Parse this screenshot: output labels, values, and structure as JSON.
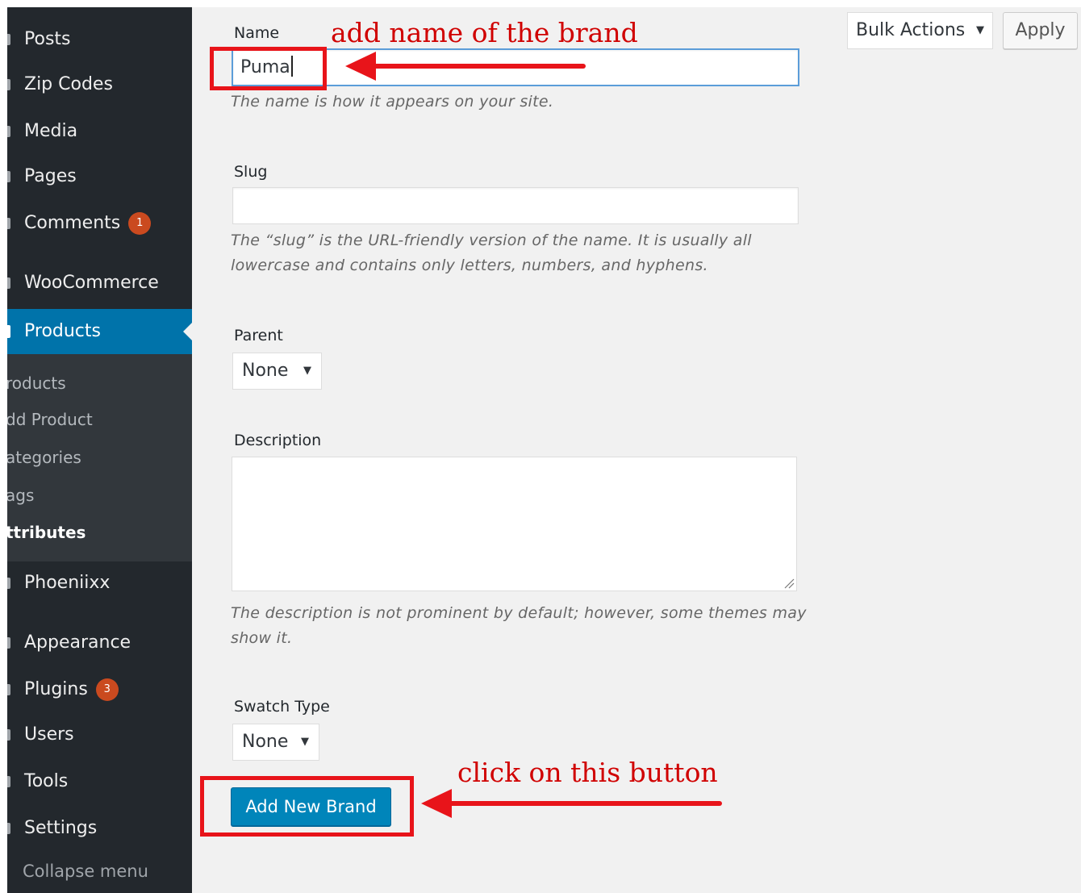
{
  "sidebar": {
    "items": [
      {
        "label": "Posts"
      },
      {
        "label": "Zip Codes"
      },
      {
        "label": "Media"
      },
      {
        "label": "Pages"
      },
      {
        "label": "Comments",
        "badge": "1"
      },
      {
        "label": "WooCommerce"
      },
      {
        "label": "Products",
        "active": true
      },
      {
        "label": "Phoeniixx"
      },
      {
        "label": "Appearance"
      },
      {
        "label": "Plugins",
        "badge": "3"
      },
      {
        "label": "Users"
      },
      {
        "label": "Tools"
      },
      {
        "label": "Settings"
      }
    ],
    "submenu": [
      {
        "label": "roducts"
      },
      {
        "label": "dd Product"
      },
      {
        "label": "ategories"
      },
      {
        "label": "ags"
      },
      {
        "label": "ttributes",
        "current": true
      }
    ],
    "collapse_label": "Collapse menu"
  },
  "form": {
    "name": {
      "label": "Name",
      "value": "Puma",
      "help": "The name is how it appears on your site."
    },
    "slug": {
      "label": "Slug",
      "value": "",
      "help_line1": "The “slug” is the URL-friendly version of the name. It is usually all",
      "help_line2": "lowercase and contains only letters, numbers, and hyphens."
    },
    "parent": {
      "label": "Parent",
      "selected": "None"
    },
    "description": {
      "label": "Description",
      "value": "",
      "help_line1": "The description is not prominent by default; however, some themes may",
      "help_line2": "show it."
    },
    "swatch_type": {
      "label": "Swatch Type",
      "selected": "None"
    },
    "submit_label": "Add New Brand"
  },
  "bulk": {
    "selected": "Bulk Actions",
    "apply_label": "Apply"
  },
  "annotations": {
    "name_note": "add name of the brand",
    "button_note": "click on this button",
    "color": "#e8141a"
  },
  "colors": {
    "sidebar_bg": "#23282d",
    "active_bg": "#0073aa",
    "badge": "#ca4a1f",
    "primary_button": "#0085ba"
  }
}
